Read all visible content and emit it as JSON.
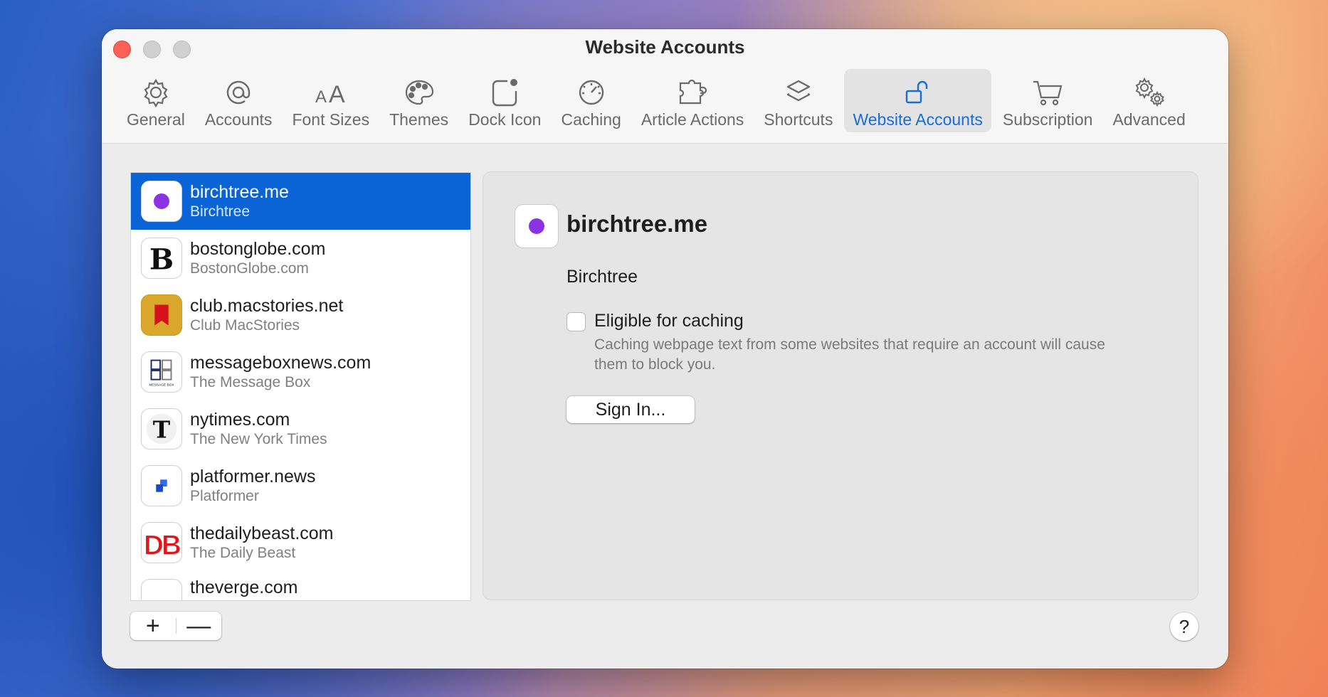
{
  "window": {
    "title": "Website Accounts"
  },
  "toolbar": {
    "tabs": [
      {
        "label": "General",
        "icon": "gear-icon"
      },
      {
        "label": "Accounts",
        "icon": "at-sign-icon"
      },
      {
        "label": "Font Sizes",
        "icon": "font-size-icon"
      },
      {
        "label": "Themes",
        "icon": "palette-icon"
      },
      {
        "label": "Dock Icon",
        "icon": "dock-badge-icon"
      },
      {
        "label": "Caching",
        "icon": "speedometer-icon"
      },
      {
        "label": "Article Actions",
        "icon": "puzzle-icon"
      },
      {
        "label": "Shortcuts",
        "icon": "shortcuts-icon"
      },
      {
        "label": "Website Accounts",
        "icon": "unlock-icon",
        "active": true
      },
      {
        "label": "Subscription",
        "icon": "cart-icon"
      },
      {
        "label": "Advanced",
        "icon": "gears-icon"
      }
    ]
  },
  "accounts": [
    {
      "domain": "birchtree.me",
      "name": "Birchtree",
      "icon": "birchtree-logo",
      "selected": true
    },
    {
      "domain": "bostonglobe.com",
      "name": "BostonGlobe.com",
      "icon": "boston-globe-logo"
    },
    {
      "domain": "club.macstories.net",
      "name": "Club MacStories",
      "icon": "macstories-logo"
    },
    {
      "domain": "messageboxnews.com",
      "name": "The Message Box",
      "icon": "message-box-logo",
      "logo_text": "MESSAGE BOX"
    },
    {
      "domain": "nytimes.com",
      "name": "The New York Times",
      "icon": "nyt-logo"
    },
    {
      "domain": "platformer.news",
      "name": "Platformer",
      "icon": "platformer-logo"
    },
    {
      "domain": "thedailybeast.com",
      "name": "The Daily Beast",
      "icon": "daily-beast-logo"
    },
    {
      "domain": "theverge.com",
      "name": "",
      "icon": "verge-logo"
    }
  ],
  "list_controls": {
    "add": "+",
    "remove": "—"
  },
  "detail": {
    "domain": "birchtree.me",
    "name": "Birchtree",
    "caching_checkbox_label": "Eligible for caching",
    "caching_checked": false,
    "caching_help": "Caching webpage text from some websites that require an account will cause them to block you.",
    "sign_in_label": "Sign In..."
  },
  "help_button": "?",
  "colors": {
    "accent": "#0a64d6",
    "close": "#fe5f57",
    "birchtree_dot": "#8a32e6"
  }
}
